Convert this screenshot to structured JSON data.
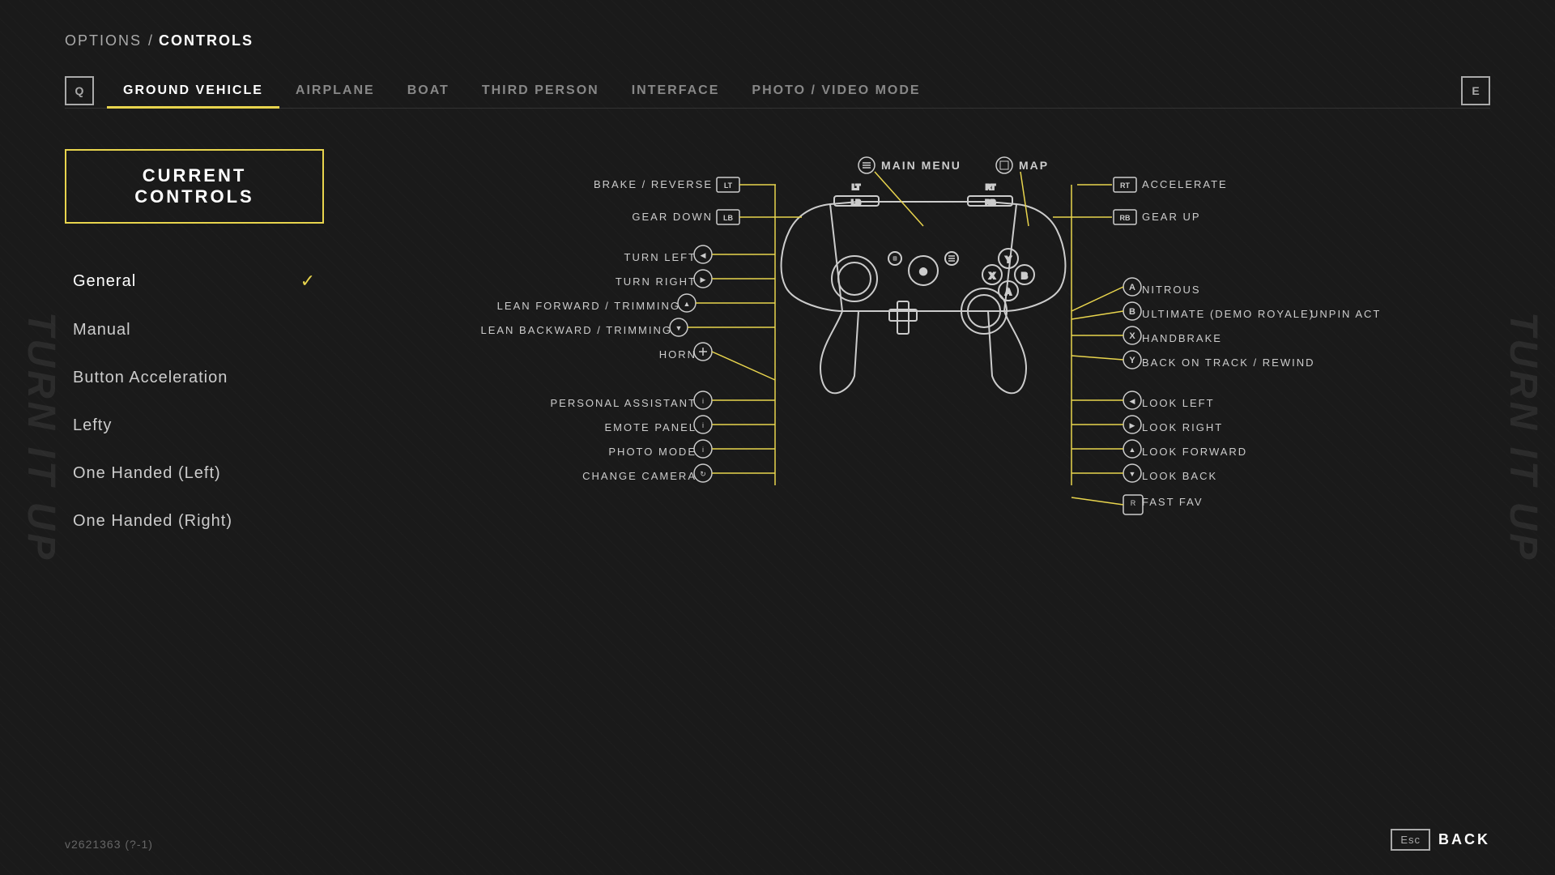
{
  "breadcrumb": {
    "options": "OPTIONS",
    "separator": "/",
    "current": "CONTROLS"
  },
  "tabs": {
    "left_icon": "Q",
    "right_icon": "E",
    "items": [
      {
        "label": "GROUND VEHICLE",
        "active": true
      },
      {
        "label": "AIRPLANE",
        "active": false
      },
      {
        "label": "BOAT",
        "active": false
      },
      {
        "label": "THIRD PERSON",
        "active": false
      },
      {
        "label": "INTERFACE",
        "active": false
      },
      {
        "label": "PHOTO / VIDEO MODE",
        "active": false
      }
    ]
  },
  "sidebar": {
    "current_controls_label": "CURRENT CONTROLS",
    "items": [
      {
        "label": "General",
        "active": true,
        "has_check": true
      },
      {
        "label": "Manual",
        "active": false,
        "has_check": false
      },
      {
        "label": "Button Acceleration",
        "active": false,
        "has_check": false
      },
      {
        "label": "Lefty",
        "active": false,
        "has_check": false
      },
      {
        "label": "One Handed (Left)",
        "active": false,
        "has_check": false
      },
      {
        "label": "One Handed (Right)",
        "active": false,
        "has_check": false
      }
    ]
  },
  "controller": {
    "top_labels": [
      {
        "icon": "menu",
        "text": "MAIN MENU"
      },
      {
        "icon": "map",
        "text": "MAP"
      }
    ],
    "left_labels": [
      {
        "button": "LT",
        "text": "BRAKE / REVERSE"
      },
      {
        "button": "LB",
        "text": "GEAR DOWN"
      },
      {
        "button": "L",
        "text": "TURN LEFT"
      },
      {
        "button": "L",
        "text": "TURN RIGHT"
      },
      {
        "button": "L",
        "text": "LEAN FORWARD / TRIMMING"
      },
      {
        "button": "L",
        "text": "LEAN BACKWARD / TRIMMING"
      },
      {
        "button": "L",
        "text": "HORN"
      },
      {
        "button": "i",
        "text": "PERSONAL ASSISTANT"
      },
      {
        "button": "i",
        "text": "EMOTE PANEL"
      },
      {
        "button": "i",
        "text": "PHOTO MODE"
      },
      {
        "button": "i",
        "text": "CHANGE CAMERA"
      }
    ],
    "right_labels": [
      {
        "button": "RT",
        "text": "ACCELERATE"
      },
      {
        "button": "RB",
        "text": "GEAR UP"
      },
      {
        "button": "A",
        "text": "NITROUS"
      },
      {
        "button": "B",
        "text": "ULTIMATE (DEMO ROYALE)",
        "extra": "UNPIN ACT"
      },
      {
        "button": "X",
        "text": "HANDBRAKE"
      },
      {
        "button": "Y",
        "text": "BACK ON TRACK / REWIND"
      },
      {
        "button": "R",
        "text": "LOOK LEFT"
      },
      {
        "button": "R",
        "text": "LOOK RIGHT"
      },
      {
        "button": "R",
        "text": "LOOK FORWARD"
      },
      {
        "button": "R",
        "text": "LOOK BACK"
      },
      {
        "button": "R",
        "text": "FAST FAV"
      }
    ]
  },
  "footer": {
    "version": "v2621363 (?-1)",
    "back_key": "Esc",
    "back_label": "BACK"
  },
  "colors": {
    "accent": "#e8d44d",
    "bg": "#1a1a1a",
    "text": "#ffffff",
    "muted": "#888888"
  }
}
